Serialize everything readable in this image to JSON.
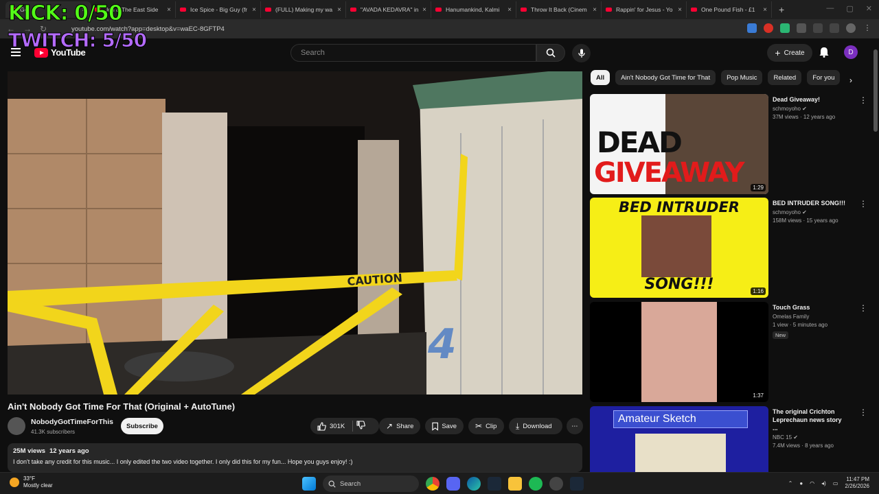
{
  "browser": {
    "tabs": [
      {
        "title": "Got"
      },
      {
        "title": "Jon & The East Side"
      },
      {
        "title": "Ice Spice - Big Guy (fr"
      },
      {
        "title": "(FULL) Making my wa"
      },
      {
        "title": "\"AVADA KEDAVRA\" in"
      },
      {
        "title": "Hanumankind, Kalmi"
      },
      {
        "title": "Throw It Back (Cinem"
      },
      {
        "title": "Rappin' for Jesus - Yo"
      },
      {
        "title": "One Pound Fish - £1"
      }
    ],
    "url": "youtube.com/watch?app=desktop&v=waEC-8GFTP4"
  },
  "overlay": {
    "kick": "KICK: 0/50",
    "twitch": "TWITCH: 5/50"
  },
  "header": {
    "logo_text": "YouTube",
    "search_placeholder": "Search",
    "create_label": "Create",
    "avatar_letter": "D"
  },
  "video": {
    "title": "Ain't Nobody Got Time For That (Original + AutoTune)",
    "channel": "NobodyGotTimeForThis",
    "subscribers": "41.3K subscribers",
    "subscribe_label": "Subscribe",
    "likes": "301K",
    "share_label": "Share",
    "save_label": "Save",
    "clip_label": "Clip",
    "download_label": "Download",
    "views": "25M views",
    "age": "12 years ago",
    "description": "I don't take any credit for this music... I only edited the two video together.  I only did this for my fun... Hope you guys enjoy! :)",
    "overlay_number": "4",
    "tape_text": "CAUTION"
  },
  "chips": [
    "All",
    "Ain't Nobody Got Time for That",
    "Pop Music",
    "Related",
    "For you"
  ],
  "recommendations": [
    {
      "title": "Dead Giveaway!",
      "channel": "schmoyoho",
      "meta": "37M views · 12 years ago",
      "duration": "1:29",
      "thumb_top": "DEAD",
      "thumb_bottom": "GIVEAWAY"
    },
    {
      "title": "BED INTRUDER SONG!!!",
      "channel": "schmoyoho",
      "meta": "158M views · 15 years ago",
      "duration": "1:16",
      "thumb_top": "BED INTRUDER",
      "thumb_bottom": "SONG!!!"
    },
    {
      "title": "Touch Grass",
      "channel": "Omelas Family",
      "meta": "1 view · 5 minutes ago",
      "badge": "New",
      "duration": "1:37"
    },
    {
      "title": "The original Crichton Leprechaun news story ...",
      "channel": "NBC 15",
      "meta": "7.4M views · 8 years ago",
      "thumb_top": "Amateur Sketch"
    }
  ],
  "taskbar": {
    "temp": "33°F",
    "weather": "Mostly clear",
    "search_label": "Search",
    "time": "11:47 PM",
    "date": "2/26/2026"
  },
  "colors": {
    "bg": "#0f0f0f",
    "kick": "#53fc18",
    "twitch": "#b46bff",
    "yt_red": "#ff0033"
  }
}
